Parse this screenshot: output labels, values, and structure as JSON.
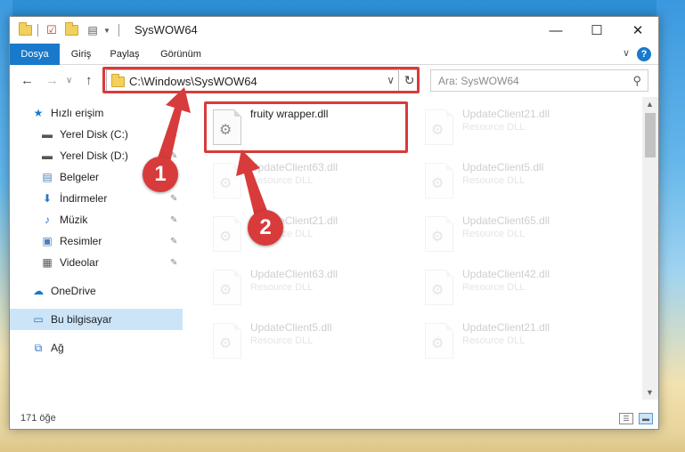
{
  "window": {
    "title": "SysWOW64",
    "minimize_glyph": "—",
    "maximize_glyph": "☐",
    "close_glyph": "✕"
  },
  "ribbon": {
    "tabs": [
      {
        "label": "Dosya",
        "active": true
      },
      {
        "label": "Giriş",
        "active": false
      },
      {
        "label": "Paylaş",
        "active": false
      },
      {
        "label": "Görünüm",
        "active": false
      }
    ],
    "help_label": "?",
    "collapse_glyph": "∨"
  },
  "nav": {
    "back_glyph": "←",
    "forward_glyph": "→",
    "history_glyph": "∨",
    "up_glyph": "↑",
    "address_path": "C:\\Windows\\SysWOW64",
    "address_dropdown_glyph": "∨",
    "refresh_glyph": "↻",
    "search_placeholder": "Ara: SysWOW64",
    "search_glyph": "⚲"
  },
  "sidebar": {
    "items": [
      {
        "label": "Hızlı erişim",
        "icon": "star-icon",
        "glyph": "★",
        "color": "#1979ca",
        "pinned": false,
        "selected": false
      },
      {
        "label": "Yerel Disk (C:)",
        "icon": "drive-icon",
        "glyph": "▬",
        "color": "#555555",
        "pinned": true,
        "selected": false
      },
      {
        "label": "Yerel Disk (D:)",
        "icon": "drive-icon",
        "glyph": "▬",
        "color": "#555555",
        "pinned": true,
        "selected": false
      },
      {
        "label": "Belgeler",
        "icon": "documents-icon",
        "glyph": "▤",
        "color": "#4a7fb5",
        "pinned": true,
        "selected": false
      },
      {
        "label": "İndirmeler",
        "icon": "download-icon",
        "glyph": "⬇",
        "color": "#2a75c8",
        "pinned": true,
        "selected": false
      },
      {
        "label": "Müzik",
        "icon": "music-icon",
        "glyph": "♪",
        "color": "#2a75c8",
        "pinned": true,
        "selected": false
      },
      {
        "label": "Resimler",
        "icon": "pictures-icon",
        "glyph": "▣",
        "color": "#4a7fb5",
        "pinned": true,
        "selected": false
      },
      {
        "label": "Videolar",
        "icon": "videos-icon",
        "glyph": "▦",
        "color": "#555555",
        "pinned": true,
        "selected": false
      },
      {
        "label": "OneDrive",
        "icon": "cloud-icon",
        "glyph": "☁",
        "color": "#1979ca",
        "pinned": false,
        "selected": false
      },
      {
        "label": "Bu bilgisayar",
        "icon": "computer-icon",
        "glyph": "▭",
        "color": "#2a75c8",
        "pinned": false,
        "selected": true
      },
      {
        "label": "Ağ",
        "icon": "network-icon",
        "glyph": "⧉",
        "color": "#2a75c8",
        "pinned": false,
        "selected": false
      }
    ],
    "pin_glyph": "✎"
  },
  "files": [
    {
      "name": "fruity wrapper.dll",
      "type": "",
      "faded": false
    },
    {
      "name": "UpdateClient21.dll",
      "type": "Resource DLL",
      "faded": true
    },
    {
      "name": "UpdateClient63.dll",
      "type": "Resource DLL",
      "faded": true
    },
    {
      "name": "UpdateClient5.dll",
      "type": "Resource DLL",
      "faded": true
    },
    {
      "name": "UpdateClient21.dll",
      "type": "Resource DLL",
      "faded": true
    },
    {
      "name": "UpdateClient65.dll",
      "type": "Resource DLL",
      "faded": true
    },
    {
      "name": "UpdateClient63.dll",
      "type": "Resource DLL",
      "faded": true
    },
    {
      "name": "UpdateClient42.dll",
      "type": "Resource DLL",
      "faded": true
    },
    {
      "name": "UpdateClient5.dll",
      "type": "Resource DLL",
      "faded": true
    },
    {
      "name": "UpdateClient21.dll",
      "type": "Resource DLL",
      "faded": true
    }
  ],
  "status": {
    "item_count": "171 öğe",
    "details_view_glyph": "☰",
    "tiles_view_glyph": "▬"
  },
  "annotations": {
    "badge1": "1",
    "badge2": "2",
    "color": "#d83b3b"
  }
}
